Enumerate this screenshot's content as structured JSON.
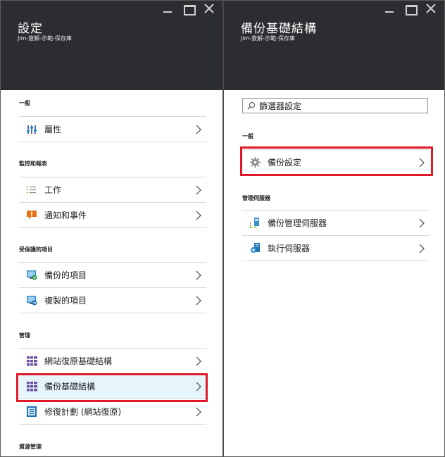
{
  "left_blade": {
    "title": "設定",
    "subtitle": "Jim-簽解-示範-保存庫",
    "sections": [
      {
        "label": "一般",
        "items": [
          {
            "label": "屬性",
            "icon": "properties-icon"
          }
        ]
      },
      {
        "label": "監控和報表",
        "items": [
          {
            "label": "工作",
            "icon": "jobs-icon"
          },
          {
            "label": "通知和事件",
            "icon": "alert-icon"
          }
        ]
      },
      {
        "label": "受保護的項目",
        "items": [
          {
            "label": "備份的項目",
            "icon": "backup-items-icon"
          },
          {
            "label": "複製的項目",
            "icon": "replicated-items-icon"
          }
        ]
      },
      {
        "label": "管理",
        "items": [
          {
            "label": "網站復原基礎結構",
            "icon": "site-recovery-infra-icon"
          },
          {
            "label": "備份基礎結構",
            "icon": "backup-infra-icon"
          },
          {
            "label": "修復計劃 (網站復原)",
            "icon": "recovery-plan-icon"
          }
        ]
      },
      {
        "label": "資源管理",
        "items": []
      }
    ]
  },
  "right_blade": {
    "title": "備份基礎結構",
    "subtitle": "Jim-簽解-示範-保存庫",
    "filter": {
      "value": "篩選器設定",
      "placeholder": "篩選器設定"
    },
    "sections": [
      {
        "label": "一般",
        "items": [
          {
            "label": "備份設定",
            "icon": "gear-icon"
          }
        ]
      },
      {
        "label": "管理伺服器",
        "items": [
          {
            "label": "備份管理伺服器",
            "icon": "backup-server-icon"
          },
          {
            "label": "執行伺服器",
            "icon": "run-server-icon"
          }
        ]
      }
    ]
  },
  "colors": {
    "header_bg": "#2b2d31",
    "highlight": "#e0182a",
    "selected_bg": "#e6f4fc",
    "divider": "#d8d8d8"
  }
}
